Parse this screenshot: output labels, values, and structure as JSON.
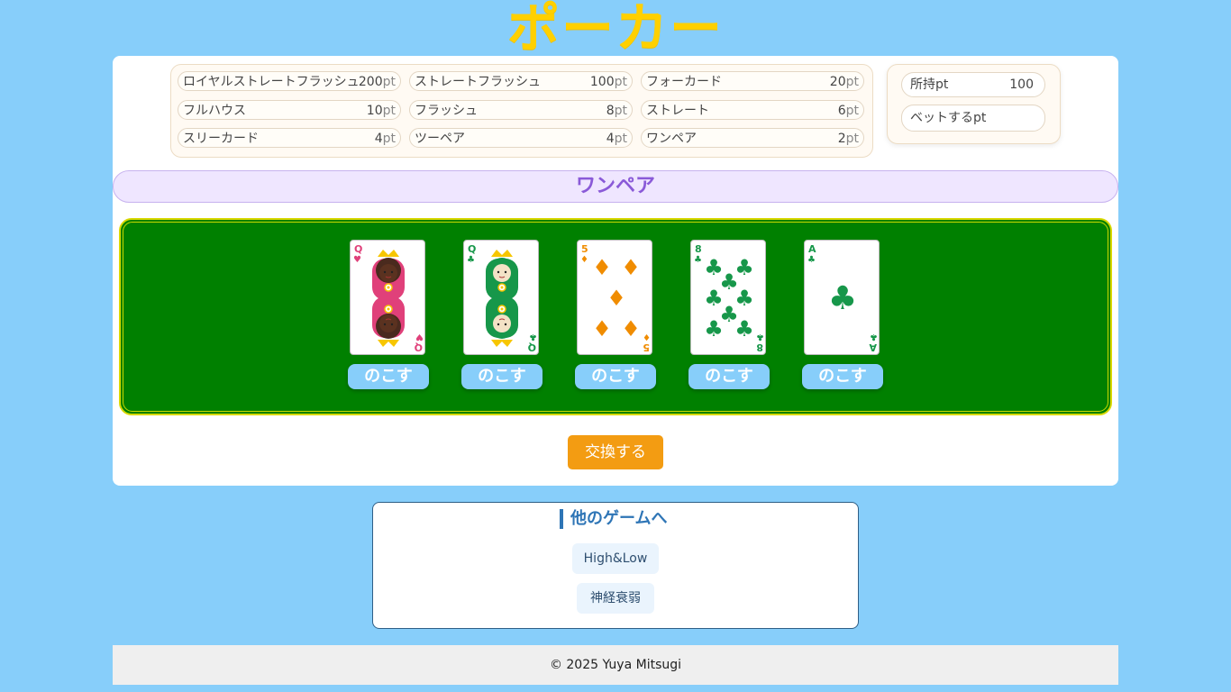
{
  "title": "ポーカー",
  "payout_table": [
    {
      "hand": "ロイヤルストレートフラッシュ",
      "points": "200",
      "unit": "pt"
    },
    {
      "hand": "ストレートフラッシュ",
      "points": "100",
      "unit": "pt"
    },
    {
      "hand": "フォーカード",
      "points": "20",
      "unit": "pt"
    },
    {
      "hand": "フルハウス",
      "points": "10",
      "unit": "pt"
    },
    {
      "hand": "フラッシュ",
      "points": "8",
      "unit": "pt"
    },
    {
      "hand": "ストレート",
      "points": "6",
      "unit": "pt"
    },
    {
      "hand": "スリーカード",
      "points": "4",
      "unit": "pt"
    },
    {
      "hand": "ツーペア",
      "points": "4",
      "unit": "pt"
    },
    {
      "hand": "ワンペア",
      "points": "2",
      "unit": "pt"
    }
  ],
  "status": {
    "owned_label": "所持pt",
    "owned_value": "100",
    "bet_label": "ベットするpt",
    "bet_value": ""
  },
  "hand_result": "ワンペア",
  "cards": [
    {
      "rank": "Q",
      "suit": "heart",
      "suit_symbol": "♥",
      "color": "#e0407a",
      "face": "queen-dark"
    },
    {
      "rank": "Q",
      "suit": "club",
      "suit_symbol": "♣",
      "color": "#17974a",
      "face": "queen-light"
    },
    {
      "rank": "5",
      "suit": "diamond",
      "suit_symbol": "♦",
      "color": "#f08c00",
      "face": "pips"
    },
    {
      "rank": "8",
      "suit": "club",
      "suit_symbol": "♣",
      "color": "#17974a",
      "face": "pips"
    },
    {
      "rank": "A",
      "suit": "club",
      "suit_symbol": "♣",
      "color": "#17974a",
      "face": "ace"
    }
  ],
  "keep_label": "のこす",
  "exchange_label": "交換する",
  "other_games": {
    "title": "他のゲームへ",
    "links": [
      "High&Low",
      "神経衰弱"
    ]
  },
  "footer": "© 2025 Yuya Mitsugi",
  "colors": {
    "background": "#87cefa",
    "title": "#ffd000",
    "table": "#008000",
    "exchange": "#f39c12",
    "result": "#8a5ad8"
  }
}
